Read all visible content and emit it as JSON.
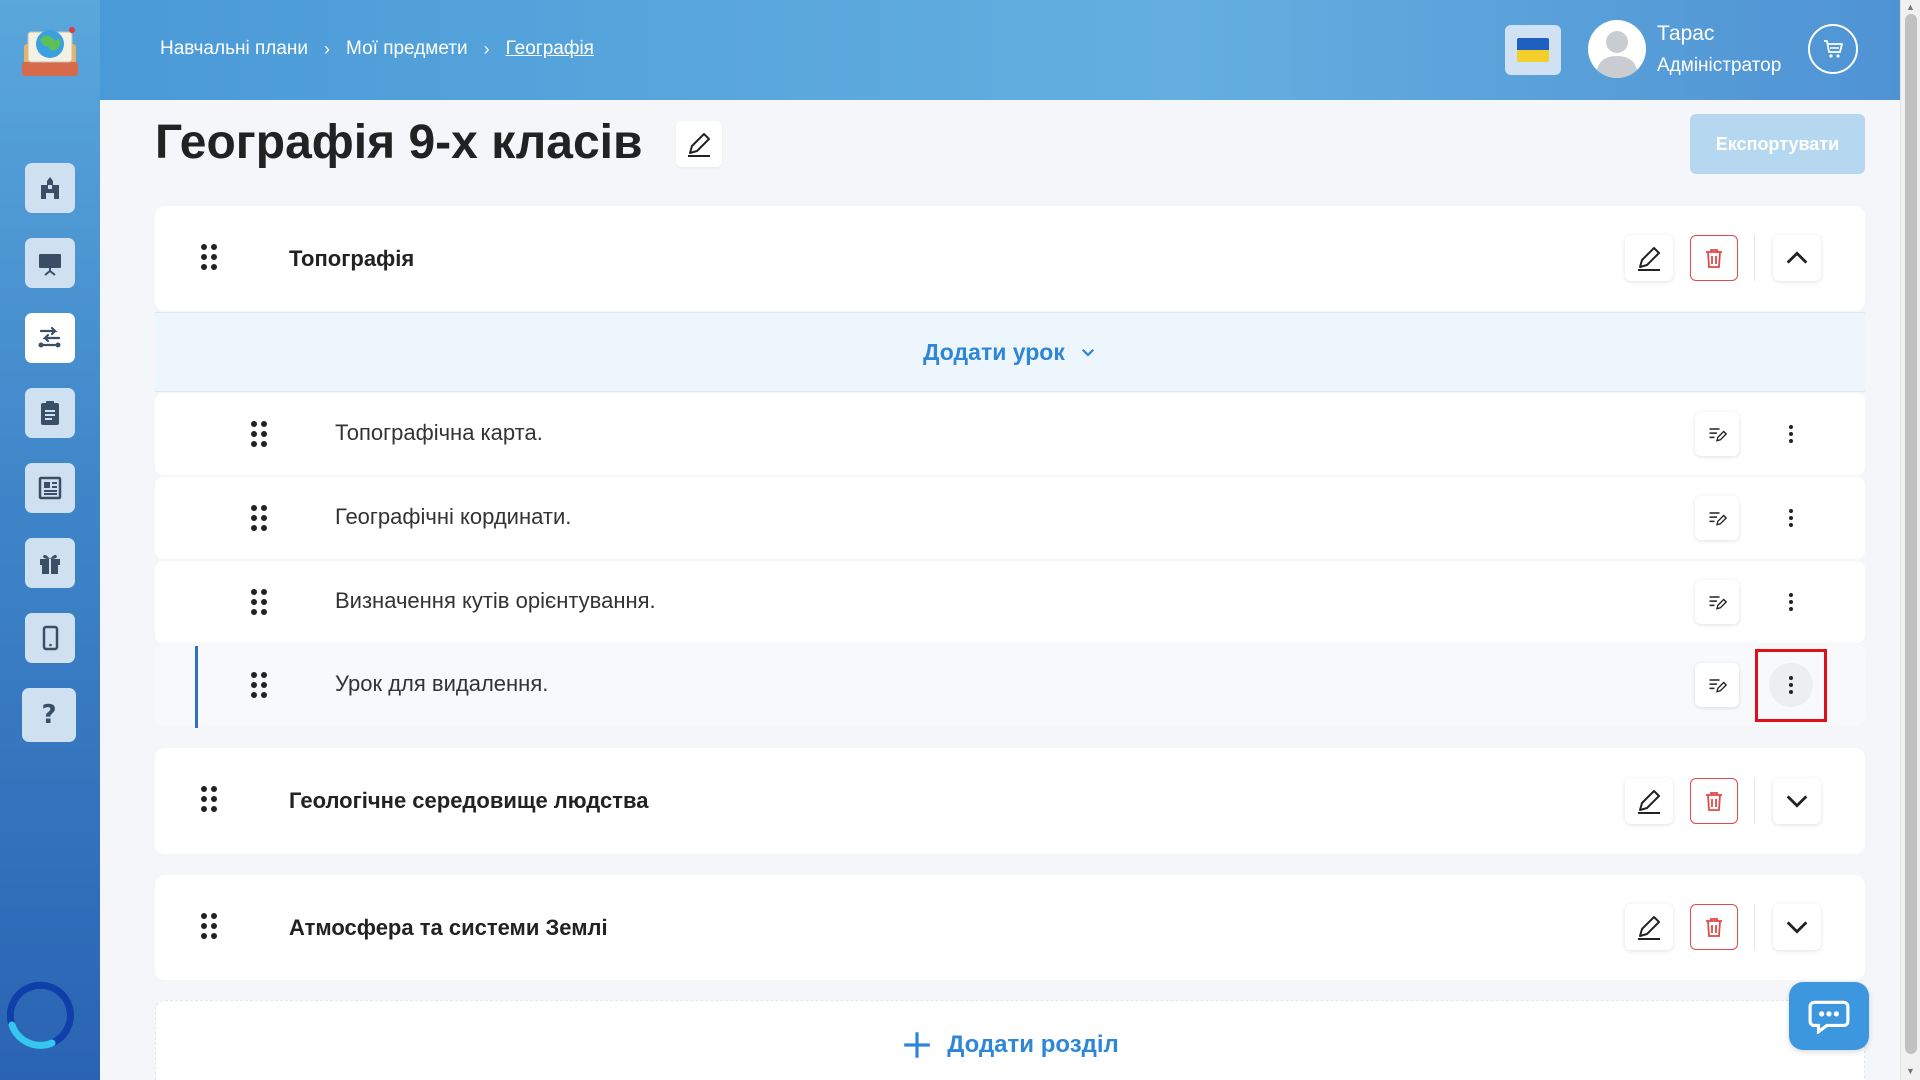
{
  "breadcrumb": {
    "item1": "Навчальні плани",
    "item2": "Мої предмети",
    "current": "Географія",
    "separator": "›"
  },
  "user": {
    "name": "Тарас",
    "role": "Адміністратор"
  },
  "page": {
    "title": "Географія 9-х класів",
    "export_label": "Експортувати"
  },
  "sections": [
    {
      "title": "Топографія",
      "expanded": true
    },
    {
      "title": "Геологічне середовище людства",
      "expanded": false
    },
    {
      "title": "Атмосфера та системи Землі",
      "expanded": false
    }
  ],
  "add_lesson_label": "Додати урок",
  "lessons": [
    {
      "title": "Топографічна карта."
    },
    {
      "title": "Географічні кординати."
    },
    {
      "title": "Визначення кутів орієнтування."
    },
    {
      "title": "Урок для видалення."
    }
  ],
  "add_section_label": "Додати розділ",
  "sidebar_icons": [
    "school-icon",
    "presentation-icon",
    "route-icon",
    "clipboard-icon",
    "document-icon",
    "gift-icon",
    "mobile-icon",
    "help-icon"
  ],
  "colors": {
    "accent": "#2e86d6",
    "danger": "#e04a4a",
    "highlight": "#e0101a"
  }
}
